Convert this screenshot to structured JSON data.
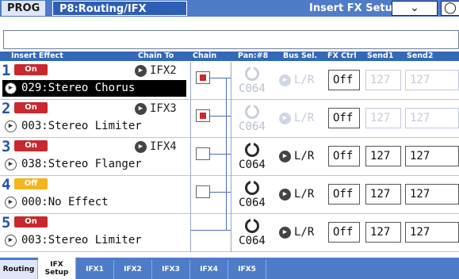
{
  "header": {
    "mode": "PROG",
    "page": "P8:Routing/IFX",
    "section": "Insert FX Setup",
    "menu_icon": "chevron-down-icon",
    "utility_icon": "utility-icon"
  },
  "columns": {
    "insert_effect": "Insert Effect",
    "chain_to": "Chain To",
    "chain": "Chain",
    "pan": "Pan:#8",
    "bus_sel": "Bus Sel.",
    "fx_ctrl": "FX Ctrl",
    "send1": "Send1",
    "send2": "Send2"
  },
  "rows": [
    {
      "num": "1",
      "state": "On",
      "chain_to": "IFX2",
      "effect": "029:Stereo Chorus",
      "pan": "C064",
      "bus": "L/R",
      "fx_ctrl": "Off",
      "send1": "127",
      "send2": "127"
    },
    {
      "num": "2",
      "state": "On",
      "chain_to": "IFX3",
      "effect": "003:Stereo Limiter",
      "pan": "C064",
      "bus": "L/R",
      "fx_ctrl": "Off",
      "send1": "127",
      "send2": "127"
    },
    {
      "num": "3",
      "state": "On",
      "chain_to": "IFX4",
      "effect": "038:Stereo Flanger",
      "pan": "C064",
      "bus": "L/R",
      "fx_ctrl": "Off",
      "send1": "127",
      "send2": "127"
    },
    {
      "num": "4",
      "state": "Off",
      "chain_to": "",
      "effect": "000:No Effect",
      "pan": "C064",
      "bus": "L/R",
      "fx_ctrl": "Off",
      "send1": "127",
      "send2": "127"
    },
    {
      "num": "5",
      "state": "On",
      "chain_to": "",
      "effect": "003:Stereo Limiter",
      "pan": "C064",
      "bus": "L/R",
      "fx_ctrl": "Off",
      "send1": "127",
      "send2": "127"
    }
  ],
  "tabs": [
    {
      "label": "Routing"
    },
    {
      "label": "IFX",
      "label2": "Setup"
    },
    {
      "label": "IFX1"
    },
    {
      "label": "IFX2"
    },
    {
      "label": "IFX3"
    },
    {
      "label": "IFX4"
    },
    {
      "label": "IFX5"
    }
  ],
  "colors": {
    "accent": "#4f7cc9",
    "on": "#c8282e",
    "off": "#f2b51d",
    "selected": "#000000"
  }
}
